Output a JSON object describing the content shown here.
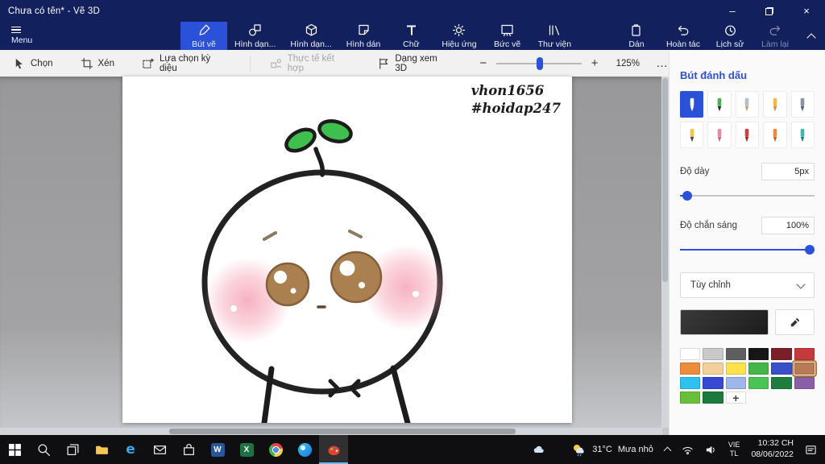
{
  "window": {
    "title": "Chưa có tên* - Vẽ 3D"
  },
  "icons": {
    "minimize": "–",
    "close": "×",
    "more": "…",
    "zoom_out": "−",
    "zoom_in": "+",
    "add_color": "+"
  },
  "ribbon": {
    "menu_label": "Menu",
    "tabs": [
      {
        "label": "Bút vẽ"
      },
      {
        "label": "Hình dạn..."
      },
      {
        "label": "Hình dạn..."
      },
      {
        "label": "Hình dán"
      },
      {
        "label": "Chữ"
      },
      {
        "label": "Hiệu ứng"
      },
      {
        "label": "Bức vẽ"
      },
      {
        "label": "Thư viện"
      }
    ],
    "actions": [
      {
        "label": "Dán"
      },
      {
        "label": "Hoàn tác"
      },
      {
        "label": "Lịch sử"
      },
      {
        "label": "Làm lại"
      }
    ]
  },
  "toolbar": {
    "select": "Chọn",
    "crop": "Xén",
    "magic_select": "Lựa chọn kỳ diệu",
    "mixed_reality": "Thực tế kết hợp",
    "view_3d": "Dạng xem 3D",
    "zoom_level": "125%"
  },
  "canvas": {
    "signature_line1": "vhon1656",
    "signature_line2": "#hoidap247"
  },
  "panel": {
    "title": "Bút đánh dấu",
    "thickness_label": "Độ dày",
    "thickness_value": "5px",
    "opacity_label": "Độ chắn sáng",
    "opacity_value": "100%",
    "customize_label": "Tùy chỉnh",
    "accent": "#2b51d8",
    "brushes": [
      {
        "name": "marker",
        "body": "#ffffff",
        "tip": "#ffffff",
        "selected": true
      },
      {
        "name": "calligraphy-pen",
        "body": "#4caf50",
        "tip": "#23351f"
      },
      {
        "name": "oil-brush",
        "body": "#b9bcc9",
        "tip": "#c9a169"
      },
      {
        "name": "watercolor",
        "body": "#f0b93f",
        "tip": "#e2813a"
      },
      {
        "name": "pixel-pen",
        "body": "#8a94a8",
        "tip": "#555f73"
      },
      {
        "name": "pencil",
        "body": "#f2c63f",
        "tip": "#454545"
      },
      {
        "name": "eraser",
        "body": "#ef87a8",
        "tip": "#d9608c"
      },
      {
        "name": "crayon",
        "body": "#d2413a",
        "tip": "#9e2a26"
      },
      {
        "name": "spray-can",
        "body": "#ef8a3c",
        "tip": "#bf6524"
      },
      {
        "name": "fill",
        "body": "#3bb8b0",
        "tip": "#237f7a"
      }
    ],
    "current_color": "#1c1c1c",
    "palette": [
      "#ffffff",
      "#c9c9c9",
      "#5f5f5f",
      "#161616",
      "#7a1f28",
      "#c43a3e",
      "#ee8c3e",
      "#f3cf9b",
      "#ffe14a",
      "#43b649",
      "#3a50c8",
      "#b97a56",
      "#2fc1ef",
      "#3748d2",
      "#9fb6ea",
      "#49c556",
      "#1f7e3d",
      "#8a5fa8",
      "#6abf3a",
      "#1d7a3e"
    ],
    "selected_color_index": 11
  },
  "taskbar": {
    "weather_temp": "31°C",
    "weather_desc": "Mưa nhỏ",
    "lang_top": "VIE",
    "lang_bottom": "TL",
    "time": "10:32 CH",
    "date": "08/06/2022",
    "app_letters": {
      "edge": "e",
      "word": "W",
      "excel": "X"
    }
  }
}
